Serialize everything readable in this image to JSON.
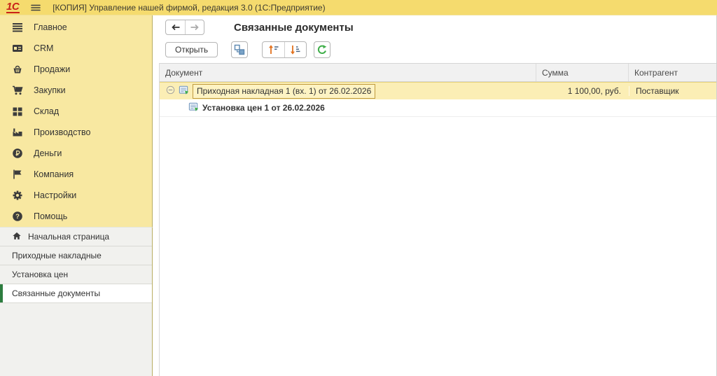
{
  "topbar": {
    "title": "[КОПИЯ] Управление нашей фирмой, редакция 3.0 (1С:Предприятие)",
    "logo": "1С"
  },
  "colors": {
    "topbar_bg": "#f5db6e",
    "sidebar_bg": "#f8e8a1",
    "active_tab_marker": "#2d7d3f",
    "selected_row_bg": "#fbeeb5",
    "selected_cell_border": "#c09a3e",
    "logo_red": "#c92219",
    "refresh_green": "#3fae49",
    "sort_orange": "#e2711d",
    "hierarchy_blue": "#5b87b0"
  },
  "sidebar": {
    "items": [
      {
        "label": "Главное",
        "icon": "menu-lines-icon"
      },
      {
        "label": "CRM",
        "icon": "contact-card-icon"
      },
      {
        "label": "Продажи",
        "icon": "basket-icon"
      },
      {
        "label": "Закупки",
        "icon": "cart-icon"
      },
      {
        "label": "Склад",
        "icon": "grid-icon"
      },
      {
        "label": "Производство",
        "icon": "factory-icon"
      },
      {
        "label": "Деньги",
        "icon": "ruble-icon"
      },
      {
        "label": "Компания",
        "icon": "flag-icon"
      },
      {
        "label": "Настройки",
        "icon": "gear-icon"
      },
      {
        "label": "Помощь",
        "icon": "help-icon"
      }
    ],
    "tabs": [
      {
        "label": "Начальная страница",
        "icon": "home-icon",
        "active": false
      },
      {
        "label": "Приходные накладные",
        "active": false
      },
      {
        "label": "Установка цен",
        "active": false
      },
      {
        "label": "Связанные документы",
        "active": true
      }
    ]
  },
  "main": {
    "title": "Связанные документы",
    "toolbar": {
      "open_label": "Открыть"
    },
    "table": {
      "columns": [
        "Документ",
        "Сумма",
        "Контрагент"
      ],
      "rows": [
        {
          "document": "Приходная накладная 1 (вх. 1) от 26.02.2026",
          "sum": "1 100,00, руб.",
          "contractor": "Поставщик",
          "selected": true,
          "level": 0
        },
        {
          "document": "Установка цен 1 от 26.02.2026",
          "sum": "",
          "contractor": "",
          "selected": false,
          "level": 1
        }
      ]
    }
  }
}
